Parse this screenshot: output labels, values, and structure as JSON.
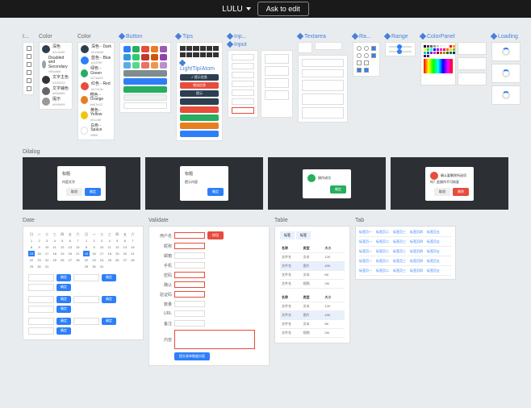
{
  "topbar": {
    "title": "LULU",
    "ask": "Ask to edit"
  },
  "sections": {
    "icons": "I...",
    "color1": "Color",
    "color2": "Color",
    "button": "Button",
    "tips": "Tips",
    "lighttip": "LightTip/Atom",
    "input_hdr": "Inp...",
    "input": "Input",
    "textarea": "Textarea",
    "radio": "Ra...",
    "range": "Range",
    "colorpanel": "ColorPanel",
    "loading": "Loading",
    "dialog": "Dilalog",
    "date": "Date",
    "validate": "Validate",
    "table": "Table",
    "tab": "Tab"
  },
  "colors1": [
    {
      "c": "#2c3e50",
      "t": "深色",
      "s": "#2c3e50"
    },
    {
      "c": "#95a5a6",
      "t": "Disabled and Secondary",
      "s": "#95a5a6"
    },
    {
      "c": "#333333",
      "t": "文字主色",
      "s": "#333333"
    },
    {
      "c": "#666666",
      "t": "文字辅色",
      "s": "#666666"
    },
    {
      "c": "#999999",
      "t": "提示",
      "s": "#999999"
    }
  ],
  "colors2": [
    {
      "c": "#2c3e50",
      "t": "深色 - Dark",
      "s": "#2c3e50"
    },
    {
      "c": "#2d7ff9",
      "t": "蓝色 - Blue",
      "s": "#2d7ff9"
    },
    {
      "c": "#27ae60",
      "t": "绿色 - Green",
      "s": "#27ae60"
    },
    {
      "c": "#e74c3c",
      "t": "红色 - Red",
      "s": "#e74c3c"
    },
    {
      "c": "#e67e22",
      "t": "橙色 - Orange",
      "s": "#e67e22"
    },
    {
      "c": "#f1c40f",
      "t": "黄色 - Yellow",
      "s": "#f1c40f"
    },
    {
      "c": "#ffffff",
      "t": "白色 - Space",
      "s": "#ffffff"
    }
  ],
  "btn_colors": [
    [
      "#2d7ff9",
      "#27ae60",
      "#e74c3c",
      "#e67e22",
      "#9b59b6"
    ],
    [
      "#3498db",
      "#2ecc71",
      "#c0392b",
      "#d35400",
      "#8e44ad"
    ],
    [
      "#5dade2",
      "#58d68d",
      "#ec7063",
      "#eb984e",
      "#bb8fce"
    ]
  ],
  "btn_long": [
    "#7f8c8d",
    "#2d7ff9",
    "#27ae60",
    "#ecf0f1",
    "#ffffff"
  ],
  "tips": [
    {
      "c": "#2c3e50",
      "t": "✓ 提示信息"
    },
    {
      "c": "#e74c3c",
      "t": "错误信息"
    },
    {
      "c": "#2c3e50",
      "t": "提示"
    },
    {
      "c": "#2c3e50",
      "t": ""
    },
    {
      "c": "#e74c3c",
      "t": ""
    },
    {
      "c": "#27ae60",
      "t": ""
    },
    {
      "c": "#e67e22",
      "t": ""
    },
    {
      "c": "#2d7ff9",
      "t": ""
    }
  ],
  "dialogs": [
    {
      "title": "标题",
      "body": "内容文字",
      "icon": null,
      "btns": [
        {
          "t": "取消",
          "v": "sec"
        },
        {
          "t": "确定",
          "v": "pri"
        }
      ]
    },
    {
      "title": "标题",
      "body": "提示内容",
      "icon": null,
      "btns": [
        {
          "t": "确定",
          "v": "pri"
        }
      ]
    },
    {
      "title": "",
      "body": "操作成功",
      "icon": "#27ae60",
      "btns": [
        {
          "t": "确定",
          "v": "grn"
        }
      ]
    },
    {
      "title": "",
      "body": "确认要删除所选项吗？此操作不可恢复",
      "icon": "#e74c3c",
      "btns": [
        {
          "t": "取消",
          "v": "sec"
        },
        {
          "t": "删除",
          "v": "red"
        }
      ]
    }
  ],
  "calendar": {
    "days": [
      "日",
      "一",
      "二",
      "三",
      "四",
      "五",
      "六"
    ],
    "dates": [
      1,
      2,
      3,
      4,
      5,
      6,
      7,
      8,
      9,
      10,
      11,
      12,
      13,
      14,
      15,
      16,
      17,
      18,
      19,
      20,
      21,
      22,
      23,
      24,
      25,
      26,
      27,
      28,
      29,
      30,
      31
    ],
    "selected": 15
  },
  "validate": {
    "rows": [
      {
        "l": "用户名",
        "err": true,
        "btn": true
      },
      {
        "l": "昵称",
        "err": true
      },
      {
        "l": "邮箱",
        "err": false
      },
      {
        "l": "手机",
        "err": false
      },
      {
        "l": "密码",
        "err": true
      },
      {
        "l": "确认",
        "err": true
      },
      {
        "l": "验证码",
        "err": true
      },
      {
        "l": "数量",
        "err": false
      },
      {
        "l": "URL",
        "err": false
      },
      {
        "l": "备注",
        "err": false
      }
    ],
    "textarea_label": "内容",
    "submit": "提交表单数据内容"
  },
  "table": {
    "tabs": [
      "标签",
      "标签"
    ],
    "headers": [
      "名称",
      "类型",
      "大小"
    ],
    "rows": [
      [
        "文件名",
        "文本",
        "12K"
      ],
      [
        "文件名",
        "图片",
        "45K"
      ],
      [
        "文件名",
        "文本",
        "8K"
      ],
      [
        "文件名",
        "视频",
        "2M"
      ]
    ]
  },
  "tabs": {
    "items": [
      "标签页一",
      "标签页二",
      "标签页三",
      "标签页四",
      "标签页五"
    ],
    "rows": 5
  },
  "cp_swatches": [
    "#000",
    "#444",
    "#666",
    "#999",
    "#ccc",
    "#eee",
    "#f3f3f3",
    "#fff",
    "#f00",
    "#f90",
    "#ff0",
    "#0f0",
    "#0ff",
    "#00f",
    "#90f",
    "#f0f",
    "#e06",
    "#f60",
    "#fc0",
    "#6c0",
    "#0cc",
    "#06c",
    "#63c",
    "#c3c",
    "#900",
    "#c60",
    "#990",
    "#360",
    "#066",
    "#036",
    "#306",
    "#606"
  ]
}
